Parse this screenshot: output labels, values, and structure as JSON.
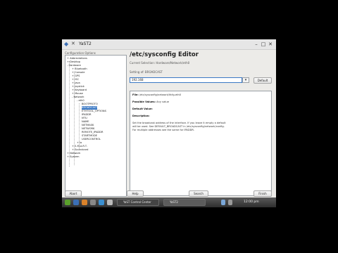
{
  "window": {
    "title": "YaST2"
  },
  "left": {
    "label": "Configuration Options",
    "tree": [
      {
        "label": "Abbreviations",
        "depth": 0,
        "prefix": "+"
      },
      {
        "label": "Desktop",
        "depth": 0,
        "prefix": "+"
      },
      {
        "label": "Hardware",
        "depth": 0,
        "prefix": "-"
      },
      {
        "label": "Bluetooth",
        "depth": 1,
        "prefix": "+"
      },
      {
        "label": "Console",
        "depth": 1,
        "prefix": "+"
      },
      {
        "label": "GPS",
        "depth": 1,
        "prefix": "+"
      },
      {
        "label": "ISC",
        "depth": 1,
        "prefix": "+"
      },
      {
        "label": "Java",
        "depth": 1,
        "prefix": "+"
      },
      {
        "label": "Joystick",
        "depth": 1,
        "prefix": "+"
      },
      {
        "label": "Keyboard",
        "depth": 1,
        "prefix": "+"
      },
      {
        "label": "Mouse",
        "depth": 1,
        "prefix": "+"
      },
      {
        "label": "Network",
        "depth": 1,
        "prefix": "-"
      },
      {
        "label": "eth0",
        "depth": 2,
        "prefix": "-"
      },
      {
        "label": "BOOTPROTO",
        "depth": 3,
        "prefix": ""
      },
      {
        "label": "BROADCAST",
        "depth": 3,
        "prefix": "",
        "selected": true
      },
      {
        "label": "ETHTOOL_OPTIONS",
        "depth": 3,
        "prefix": ""
      },
      {
        "label": "IPADDR",
        "depth": 3,
        "prefix": ""
      },
      {
        "label": "MTU",
        "depth": 3,
        "prefix": ""
      },
      {
        "label": "NAME",
        "depth": 3,
        "prefix": ""
      },
      {
        "label": "NETMASK",
        "depth": 3,
        "prefix": ""
      },
      {
        "label": "NETWORK",
        "depth": 3,
        "prefix": ""
      },
      {
        "label": "REMOTE_IPADDR",
        "depth": 3,
        "prefix": ""
      },
      {
        "label": "STARTMODE",
        "depth": 3,
        "prefix": ""
      },
      {
        "label": "USERCONTROL",
        "depth": 3,
        "prefix": ""
      },
      {
        "label": "lo",
        "depth": 2,
        "prefix": "+"
      },
      {
        "label": "S.M.A.R.T.",
        "depth": 1,
        "prefix": "+"
      },
      {
        "label": "Soundcard",
        "depth": 1,
        "prefix": "+"
      },
      {
        "label": "Network",
        "depth": 0,
        "prefix": "+"
      },
      {
        "label": "System",
        "depth": 0,
        "prefix": "+"
      }
    ]
  },
  "editor": {
    "title": "/etc/sysconfig Editor",
    "current_selection": "Current Selection: Hardware/Network/eth0",
    "setting_label": "Setting of: BROADCAST",
    "setting_value": "192.168",
    "default_button": "Default",
    "description": {
      "file_label": "File:",
      "file_value": "/etc/sysconfig/network/ifcfg-eth0",
      "possible_label": "Possible Values:",
      "possible_value": "Any value",
      "default_label": "Default Value:",
      "desc_label": "Description:",
      "lines": [
        "Set the broadcast address of the interface. If you leave it empty a default",
        "will be used. See DEFAULT_BROADCAST in /etc/sysconfig/network/config.",
        "For multiple addresses see the same for IPADDR."
      ]
    }
  },
  "buttons": {
    "abort": "Abort",
    "help": "Help",
    "search": "Search",
    "finish": "Finish"
  },
  "taskbar": {
    "tasks": [
      {
        "label": "YaST Control Center",
        "active": false
      },
      {
        "label": "YaST2",
        "active": true
      }
    ],
    "clock": "12:00 pm"
  },
  "colors": {
    "accent": "#3a78c4",
    "window_bg": "#ecebe8",
    "taskbar": "#3a3a3a"
  },
  "icons": [
    "yast-icon",
    "pin-icon",
    "minimize-icon",
    "maximize-icon",
    "close-icon",
    "dropdown-arrow-icon",
    "start-menu-icon",
    "browser-icon",
    "files-icon",
    "terminal-icon",
    "tray-network-icon",
    "tray-volume-icon"
  ]
}
